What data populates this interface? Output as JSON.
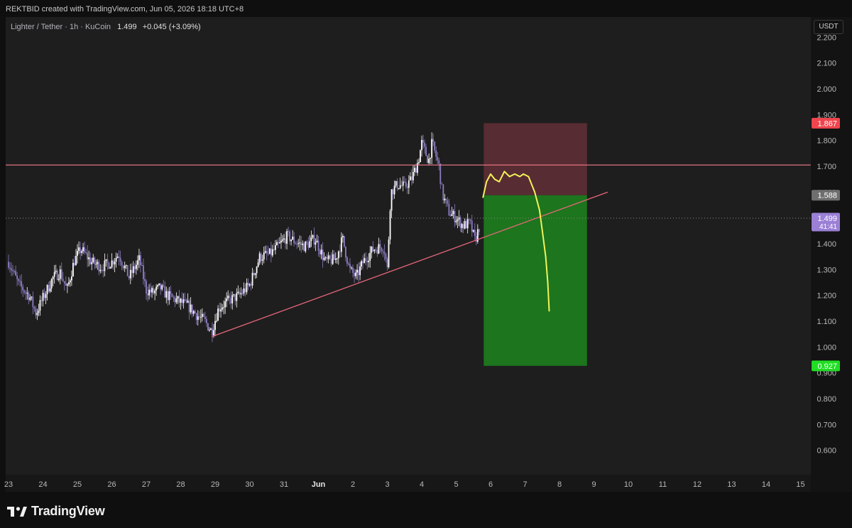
{
  "header": {
    "attribution": "REKTBID created with TradingView.com, Jun 05, 2026 18:18 UTC+8"
  },
  "legend": {
    "symbol": "Lighter / Tether · 1h · KuCoin",
    "price": "1.499",
    "change": "+0.045 (+3.09%)"
  },
  "currency_button": "USDT",
  "footer": {
    "brand": "TradingView"
  },
  "colors": {
    "background": "#1e1e1e",
    "candle_up": "#ffffff",
    "candle_down": "#8e7cc3",
    "resistance_line": "#f27c8a",
    "trendline": "#e7667a",
    "stop_zone": "#5c2d35",
    "target_zone": "#1d7a1d",
    "projection": "#f2f25a"
  },
  "chart_data": {
    "type": "candlestick",
    "symbol": "Lighter / Tether",
    "interval": "1h",
    "exchange": "KuCoin",
    "ylim": [
      0.55,
      2.2
    ],
    "y_ticks": [
      2.2,
      2.1,
      2.0,
      1.9,
      1.8,
      1.7,
      1.6,
      1.4,
      1.3,
      1.2,
      1.1,
      1.0,
      0.9,
      0.8,
      0.7,
      0.6
    ],
    "x_ticks": [
      {
        "label": "23",
        "day": 23
      },
      {
        "label": "24",
        "day": 24
      },
      {
        "label": "25",
        "day": 25
      },
      {
        "label": "26",
        "day": 26
      },
      {
        "label": "27",
        "day": 27
      },
      {
        "label": "28",
        "day": 28
      },
      {
        "label": "29",
        "day": 29
      },
      {
        "label": "30",
        "day": 30
      },
      {
        "label": "31",
        "day": 31
      },
      {
        "label": "Jun",
        "day": 32
      },
      {
        "label": "2",
        "day": 33
      },
      {
        "label": "3",
        "day": 34
      },
      {
        "label": "4",
        "day": 35
      },
      {
        "label": "5",
        "day": 36
      },
      {
        "label": "6",
        "day": 37
      },
      {
        "label": "7",
        "day": 38
      },
      {
        "label": "8",
        "day": 39
      },
      {
        "label": "9",
        "day": 40
      },
      {
        "label": "10",
        "day": 41
      },
      {
        "label": "11",
        "day": 42
      },
      {
        "label": "12",
        "day": 43
      },
      {
        "label": "13",
        "day": 44
      },
      {
        "label": "14",
        "day": 45
      },
      {
        "label": "15",
        "day": 46
      }
    ],
    "price_path": [
      [
        23.0,
        1.33
      ],
      [
        23.3,
        1.24
      ],
      [
        23.6,
        1.2
      ],
      [
        23.8,
        1.13
      ],
      [
        24.0,
        1.19
      ],
      [
        24.3,
        1.27
      ],
      [
        24.5,
        1.29
      ],
      [
        24.7,
        1.22
      ],
      [
        24.9,
        1.33
      ],
      [
        25.1,
        1.38
      ],
      [
        25.4,
        1.33
      ],
      [
        25.7,
        1.31
      ],
      [
        26.0,
        1.33
      ],
      [
        26.2,
        1.36
      ],
      [
        26.5,
        1.27
      ],
      [
        26.8,
        1.34
      ],
      [
        27.0,
        1.22
      ],
      [
        27.2,
        1.21
      ],
      [
        27.4,
        1.23
      ],
      [
        27.6,
        1.2
      ],
      [
        27.9,
        1.18
      ],
      [
        28.2,
        1.16
      ],
      [
        28.5,
        1.12
      ],
      [
        28.7,
        1.1
      ],
      [
        28.9,
        1.06
      ],
      [
        29.1,
        1.15
      ],
      [
        29.4,
        1.18
      ],
      [
        29.7,
        1.2
      ],
      [
        30.0,
        1.24
      ],
      [
        30.3,
        1.35
      ],
      [
        30.6,
        1.36
      ],
      [
        30.9,
        1.4
      ],
      [
        31.1,
        1.43
      ],
      [
        31.3,
        1.41
      ],
      [
        31.6,
        1.39
      ],
      [
        31.9,
        1.42
      ],
      [
        32.2,
        1.33
      ],
      [
        32.5,
        1.34
      ],
      [
        32.7,
        1.42
      ],
      [
        32.9,
        1.3
      ],
      [
        33.1,
        1.27
      ],
      [
        33.3,
        1.33
      ],
      [
        33.6,
        1.38
      ],
      [
        33.9,
        1.39
      ],
      [
        34.0,
        1.3
      ],
      [
        34.1,
        1.6
      ],
      [
        34.3,
        1.63
      ],
      [
        34.5,
        1.62
      ],
      [
        34.7,
        1.65
      ],
      [
        34.9,
        1.72
      ],
      [
        35.0,
        1.79
      ],
      [
        35.2,
        1.72
      ],
      [
        35.3,
        1.79
      ],
      [
        35.5,
        1.7
      ],
      [
        35.6,
        1.59
      ],
      [
        35.8,
        1.52
      ],
      [
        36.0,
        1.5
      ],
      [
        36.2,
        1.47
      ],
      [
        36.4,
        1.48
      ],
      [
        36.55,
        1.41
      ],
      [
        36.7,
        1.48
      ]
    ],
    "lines": [
      {
        "name": "resistance",
        "type": "horizontal",
        "y": 1.705
      },
      {
        "name": "trendline",
        "type": "segment",
        "from": [
          28.9,
          1.04
        ],
        "to": [
          40.4,
          1.6
        ]
      }
    ],
    "position": {
      "type": "short",
      "x_start": 36.8,
      "x_end": 39.8,
      "stop": 1.867,
      "entry": 1.588,
      "target": 0.927
    },
    "projection_path": [
      [
        36.78,
        1.58
      ],
      [
        36.88,
        1.64
      ],
      [
        37.0,
        1.67
      ],
      [
        37.12,
        1.65
      ],
      [
        37.25,
        1.64
      ],
      [
        37.4,
        1.68
      ],
      [
        37.55,
        1.66
      ],
      [
        37.7,
        1.67
      ],
      [
        37.85,
        1.66
      ],
      [
        37.95,
        1.67
      ],
      [
        38.1,
        1.66
      ],
      [
        38.28,
        1.6
      ],
      [
        38.42,
        1.53
      ],
      [
        38.5,
        1.45
      ],
      [
        38.6,
        1.35
      ],
      [
        38.66,
        1.25
      ],
      [
        38.7,
        1.14
      ]
    ],
    "price_labels": [
      {
        "label": "1.867",
        "y": 1.867,
        "color": "#f0454e"
      },
      {
        "label": "1.588",
        "y": 1.588,
        "color": "#6e6e6e"
      },
      {
        "label": "1.499",
        "sub": "41:41",
        "y": 1.499,
        "color": "#9b80d6"
      },
      {
        "label": "0.927",
        "y": 0.927,
        "color": "#1fde23"
      }
    ],
    "current_price": 1.499
  }
}
